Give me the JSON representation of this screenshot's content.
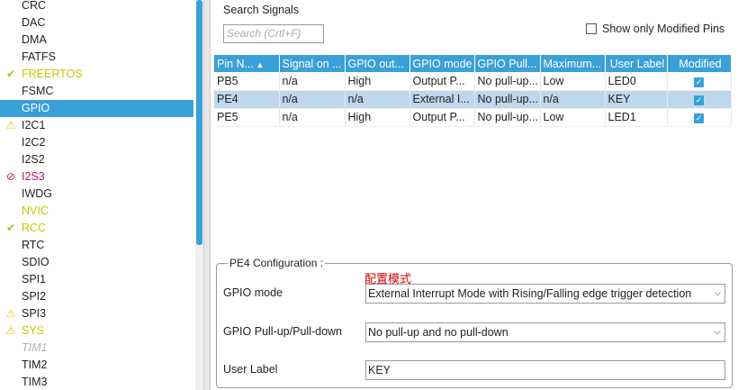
{
  "peripherals": [
    {
      "label": "CRC",
      "status": "",
      "selected": false
    },
    {
      "label": "DAC",
      "status": "",
      "selected": false
    },
    {
      "label": "DMA",
      "status": "",
      "selected": false
    },
    {
      "label": "FATFS",
      "status": "",
      "selected": false
    },
    {
      "label": "FREERTOS",
      "status": "check",
      "selected": false
    },
    {
      "label": "FSMC",
      "status": "",
      "selected": false
    },
    {
      "label": "GPIO",
      "status": "",
      "selected": true
    },
    {
      "label": "I2C1",
      "status": "warn",
      "selected": false
    },
    {
      "label": "I2C2",
      "status": "",
      "selected": false
    },
    {
      "label": "I2S2",
      "status": "",
      "selected": false
    },
    {
      "label": "I2S3",
      "status": "error",
      "selected": false
    },
    {
      "label": "IWDG",
      "status": "",
      "selected": false
    },
    {
      "label": "NVIC",
      "status": "check-text",
      "selected": false
    },
    {
      "label": "RCC",
      "status": "check",
      "selected": false
    },
    {
      "label": "RTC",
      "status": "",
      "selected": false
    },
    {
      "label": "SDIO",
      "status": "",
      "selected": false
    },
    {
      "label": "SPI1",
      "status": "",
      "selected": false
    },
    {
      "label": "SPI2",
      "status": "",
      "selected": false
    },
    {
      "label": "SPI3",
      "status": "warn",
      "selected": false
    },
    {
      "label": "SYS",
      "status": "warn-text",
      "selected": false
    },
    {
      "label": "TIM1",
      "status": "disabled",
      "selected": false
    },
    {
      "label": "TIM2",
      "status": "",
      "selected": false
    },
    {
      "label": "TIM3",
      "status": "",
      "selected": false
    }
  ],
  "search": {
    "title": "Search Signals",
    "placeholder": "Search (Crtl+F)"
  },
  "show_modified": {
    "label": "Show only Modified Pins",
    "checked": false
  },
  "table": {
    "headers": [
      "Pin N...",
      "Signal on ...",
      "GPIO out...",
      "GPIO mode",
      "GPIO Pull...",
      "Maximum...",
      "User Label",
      "Modified"
    ],
    "rows": [
      {
        "cells": [
          "PB5",
          "n/a",
          "High",
          "Output P...",
          "No pull-up...",
          "Low",
          "LED0"
        ],
        "modified": true,
        "selected": false
      },
      {
        "cells": [
          "PE4",
          "n/a",
          "n/a",
          "External I...",
          "No pull-up...",
          "n/a",
          "KEY"
        ],
        "modified": true,
        "selected": true
      },
      {
        "cells": [
          "PE5",
          "n/a",
          "High",
          "Output P...",
          "No pull-up...",
          "Low",
          "LED1"
        ],
        "modified": true,
        "selected": false
      }
    ]
  },
  "config": {
    "legend": "PE4 Configuration :",
    "note": "配置模式",
    "gpio_mode_label": "GPIO mode",
    "gpio_mode_value": "External Interrupt Mode with Rising/Falling edge trigger detection",
    "pull_label": "GPIO Pull-up/Pull-down",
    "pull_value": "No pull-up and no pull-down",
    "user_label_label": "User Label",
    "user_label_value": "KEY"
  },
  "colors": {
    "accent": "#3aa0d8",
    "warn": "#f2c300",
    "ok": "#a7c10a",
    "error": "#c0186e",
    "note": "#d00000"
  },
  "icons": {
    "check": "check-icon",
    "warn": "warning-icon",
    "error": "forbidden-icon",
    "dropdown": "chevron-down-icon",
    "sort": "sort-up-icon"
  }
}
